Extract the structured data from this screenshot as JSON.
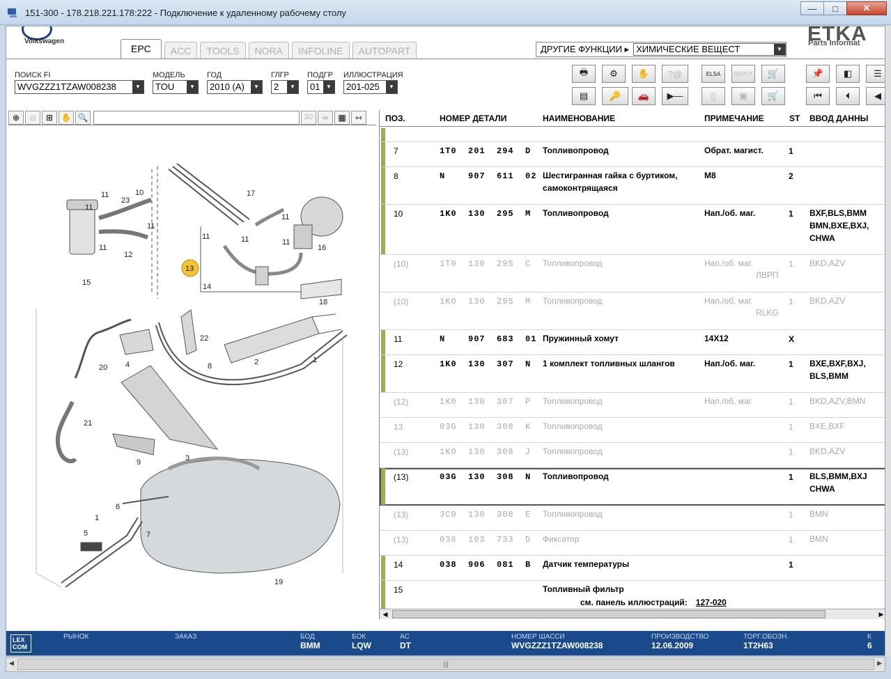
{
  "window": {
    "title": "151-300 - 178.218.221.178:222 - Подключение к удаленному рабочему столу",
    "minimize": "—",
    "maximize": "□",
    "close": "✕"
  },
  "header": {
    "brand": "Volkswagen",
    "tabs": [
      "EPC",
      "ACC",
      "TOOLS",
      "NORA",
      "INFOLINE",
      "AUTOPART"
    ],
    "active_tab": "EPC",
    "other_functions_label": "ДРУГИЕ ФУНКЦИИ ▸",
    "other_functions_value": "ХИМИЧЕСКИЕ ВЕЩЕСТ",
    "logo_text": "ETKA",
    "logo_sub": "Parts Informat"
  },
  "filters": [
    {
      "label": "ПОИСК FI",
      "value": "WVGZZZ1TZAW008238"
    },
    {
      "label": "МОДЕЛЬ",
      "value": "TOU"
    },
    {
      "label": "ГОД",
      "value": "2010 (A)"
    },
    {
      "label": "ГЛГР",
      "value": "2"
    },
    {
      "label": "ПОДГР",
      "value": "01"
    },
    {
      "label": "ИЛЛЮСТРАЦИЯ",
      "value": "201-025"
    }
  ],
  "toolbar": {
    "elsa_label": "ELSA",
    "depot_label": "DEPOT"
  },
  "zoombar": {
    "label_3d": "3D"
  },
  "table": {
    "headers": {
      "pos": "ПОЗ.",
      "num": "НОМЕР ДЕТАЛИ",
      "name": "НАИМЕНОВАНИЕ",
      "note": "ПРИМЕЧАНИЕ",
      "st": "ST",
      "inp": "ВВОД ДАННЫ"
    },
    "rows": [
      {
        "pos": "",
        "num": "",
        "name": "",
        "note": "",
        "st": "",
        "inp": "",
        "gray": false,
        "bar": true,
        "h": 20
      },
      {
        "pos": "7",
        "num": "1T0  201  294  D",
        "name": "Топливопровод",
        "note": "Обрат. магист.",
        "st": "1",
        "inp": "",
        "gray": false,
        "bar": true,
        "h": 36
      },
      {
        "pos": "8",
        "num": "N    907  611  02",
        "name": "Шестигранная гайка с буртиком,\nсамоконтрящаяся",
        "note": "M8",
        "st": "2",
        "inp": "",
        "gray": false,
        "bar": true,
        "h": 54
      },
      {
        "pos": "10",
        "num": "1K0  130  295  M",
        "name": "Топливопровод",
        "note": "Нап./об. маг.",
        "st": "1",
        "inp": "BXF,BLS,BMM\nBMN,BXE,BXJ,\nCHWA",
        "gray": false,
        "bar": true,
        "h": 72
      },
      {
        "pos": "(10)",
        "num": "1T0  130  295  C",
        "name": "Топливопровод",
        "note": "Нап./об. маг.",
        "note2": "ЛВРП",
        "st": "1",
        "inp": "BKD,AZV",
        "gray": true,
        "bar": false,
        "h": 54
      },
      {
        "pos": "(10)",
        "num": "1K0  130  295  M",
        "name": "Топливопровод",
        "note": "Нап./об. маг.",
        "note2": "RLKG",
        "st": "1",
        "inp": "BKD,AZV",
        "gray": true,
        "bar": false,
        "h": 54
      },
      {
        "pos": "11",
        "num": "N    907  683  01",
        "name": "Пружинный хомут",
        "note": "14X12",
        "st": "X",
        "inp": "",
        "gray": false,
        "bar": true,
        "h": 36
      },
      {
        "pos": "12",
        "num": "1K0  130  307  N",
        "name": "1 комплект топливных шлангов",
        "note": "Нап./об. маг.",
        "st": "1",
        "inp": "BXE,BXF,BXJ,\nBLS,BMM",
        "gray": false,
        "bar": true,
        "h": 54
      },
      {
        "pos": "(12)",
        "num": "1K0  130  307  P",
        "name": "Топливопровод",
        "note": "Нап./об. маг.",
        "st": "1",
        "inp": "BKD,AZV,BMN",
        "gray": true,
        "bar": false,
        "h": 36
      },
      {
        "pos": "13",
        "num": "03G  130  308  K",
        "name": "Топливопровод",
        "note": "",
        "st": "1",
        "inp": "BXE,BXF",
        "gray": true,
        "bar": false,
        "h": 36
      },
      {
        "pos": "(13)",
        "num": "1K0  130  308  J",
        "name": "Топливопровод",
        "note": "",
        "st": "1",
        "inp": "BKD,AZV",
        "gray": true,
        "bar": false,
        "h": 36
      },
      {
        "pos": "(13)",
        "num": "03G  130  308  N",
        "name": "Топливопровод",
        "note": "",
        "st": "1",
        "inp": "BLS,BMM,BXJ\nCHWA",
        "gray": false,
        "bar": true,
        "sel": true,
        "h": 54
      },
      {
        "pos": "(13)",
        "num": "3C0  130  308  E",
        "name": "Топливопровод",
        "note": "",
        "st": "1",
        "inp": "BMN",
        "gray": true,
        "bar": false,
        "h": 36
      },
      {
        "pos": "(13)",
        "num": "036  103  733  D",
        "name": "Фиксатор",
        "note": "",
        "st": "1",
        "inp": "BMN",
        "gray": true,
        "bar": false,
        "h": 36
      },
      {
        "pos": "14",
        "num": "038  906  081  B",
        "name": "Датчик температуры",
        "note": "",
        "st": "1",
        "inp": "",
        "gray": false,
        "bar": true,
        "h": 36
      },
      {
        "pos": "15",
        "num": "",
        "name": "Топливный фильтр",
        "note": "",
        "st": "",
        "inp": "",
        "gray": false,
        "bar": true,
        "h": 44,
        "ref_label": "см. панель иллюстраций:",
        "ref_link": "127-020"
      }
    ]
  },
  "illustration": {
    "labels": [
      "11",
      "23",
      "10",
      "11",
      "11",
      "11",
      "12",
      "15",
      "17",
      "11",
      "11",
      "11",
      "11",
      "16",
      "13",
      "14",
      "18",
      "22",
      "20",
      "4",
      "8",
      "2",
      "1",
      "21",
      "9",
      "3",
      "6",
      "1",
      "5",
      "7",
      "19"
    ],
    "callout": "13"
  },
  "status": {
    "logo": "LEX\nCOM",
    "fields": [
      {
        "label": "РЫНОК",
        "value": ""
      },
      {
        "label": "ЗАКАЗ",
        "value": ""
      },
      {
        "label": "БОД",
        "value": "BMM"
      },
      {
        "label": "БОК",
        "value": "LQW"
      },
      {
        "label": "АС",
        "value": "DT"
      },
      {
        "label": "НОМЕР ШАССИ",
        "value": "WVGZZZ1TZAW008238"
      },
      {
        "label": "ПРОИЗВОДСТВО",
        "value": "12.06.2009"
      },
      {
        "label": "ТОРГ.ОБОЗН.",
        "value": "1T2H63"
      },
      {
        "label": "К",
        "value": "6"
      }
    ]
  }
}
